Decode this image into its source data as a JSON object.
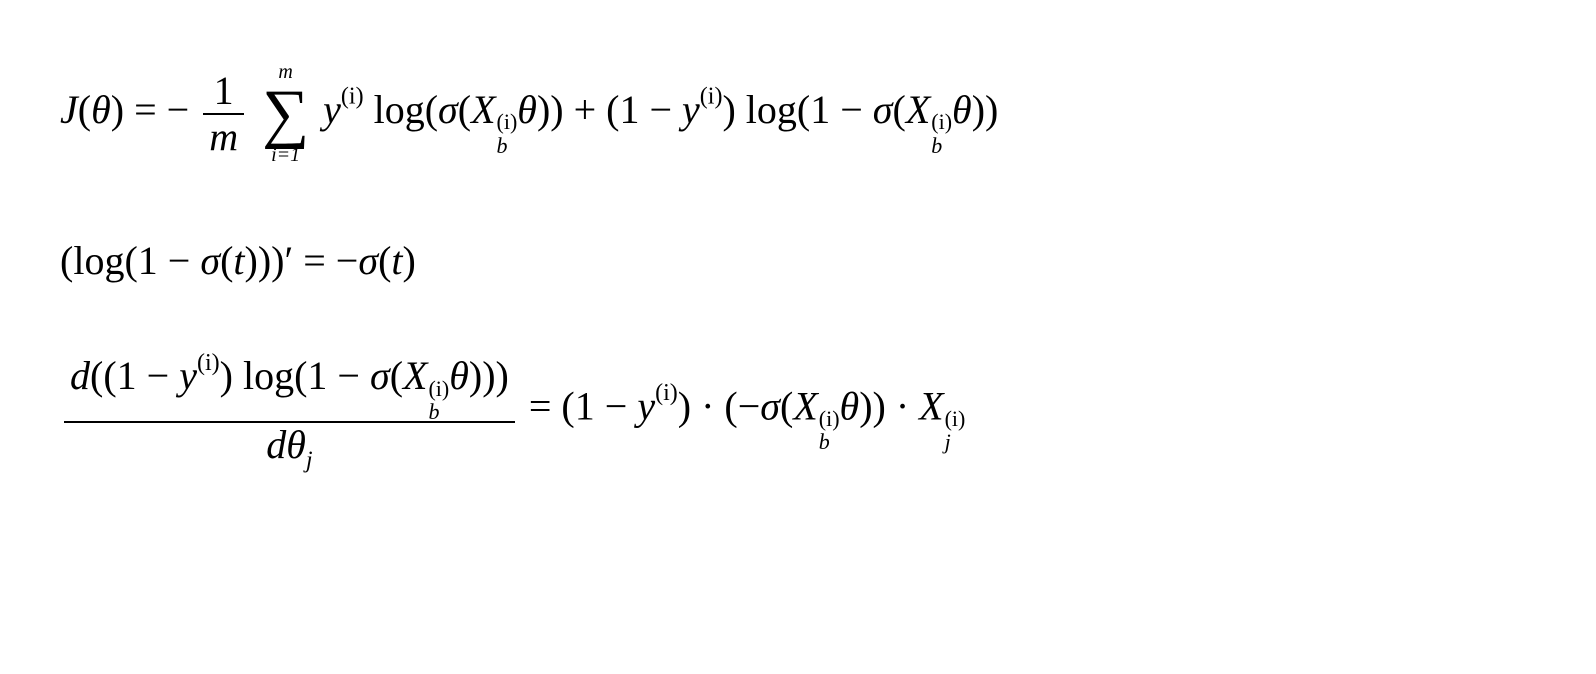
{
  "eq1": {
    "lhs_J": "J",
    "lhs_theta_open": "(",
    "lhs_theta": "θ",
    "lhs_theta_close": ")",
    "eq_sign": " = ",
    "neg": "−",
    "frac_num": "1",
    "frac_den": "m",
    "sum_top": "m",
    "sum_bottom": "i=1",
    "y": "y",
    "sup_i": "(i)",
    "log": " log(",
    "sigma": "σ",
    "X": "X",
    "sub_b": "b",
    "theta": "θ",
    "close2": "))",
    "plus": " + ",
    "open": "(",
    "one_minus": "1 − ",
    "close": ")",
    "one_minus_inside": "1 − "
  },
  "eq2": {
    "open": "(",
    "log": "log(",
    "one_minus": "1 − ",
    "sigma": "σ",
    "t": "t",
    "close3prime": ")))′",
    "eq": " = ",
    "neg": "−",
    "open2": "(",
    "close": ")"
  },
  "eq3": {
    "d": "d",
    "open": "(",
    "one_minus": "(1 − ",
    "y": "y",
    "sup_i": "(i)",
    "close": ")",
    "log": " log(",
    "one_minus2": "1 − ",
    "sigma": "σ",
    "X": "X",
    "sub_b": "b",
    "theta": "θ",
    "close3": ")))",
    "den_d": "d",
    "den_theta": "θ",
    "den_sub_j": "j",
    "eq": " = ",
    "dot": " · ",
    "neg_open": "(−",
    "close2": "))",
    "sub_j": "j"
  }
}
